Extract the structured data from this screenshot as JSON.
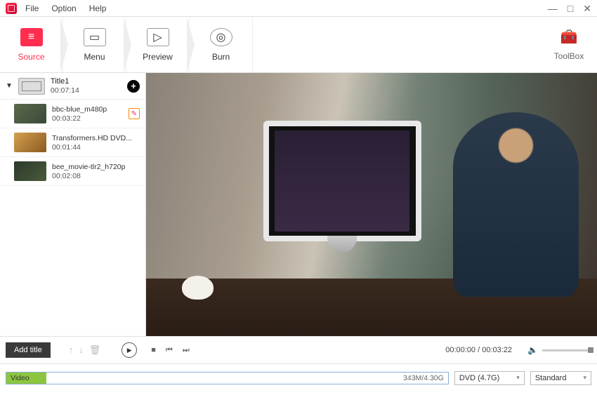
{
  "menubar": {
    "file": "File",
    "option": "Option",
    "help": "Help"
  },
  "ribbon": {
    "source": "Source",
    "menu": "Menu",
    "preview": "Preview",
    "burn": "Burn",
    "toolbox": "ToolBox"
  },
  "sidebar": {
    "title": {
      "name": "Title1",
      "duration": "00:07:14"
    },
    "clips": [
      {
        "name": "bbc-blue_m480p",
        "duration": "00:03:22",
        "selected": true
      },
      {
        "name": "Transformers.HD DVD...",
        "duration": "00:01:44",
        "selected": false
      },
      {
        "name": "bee_movie-tlr2_h720p",
        "duration": "00:02:08",
        "selected": false
      }
    ]
  },
  "controls": {
    "add_title": "Add title",
    "time_current": "00:00:00",
    "time_total": "00:03:22"
  },
  "bottom": {
    "track_label": "Video",
    "capacity": "343M/4.30G",
    "disc": "DVD (4.7G)",
    "quality": "Standard"
  }
}
